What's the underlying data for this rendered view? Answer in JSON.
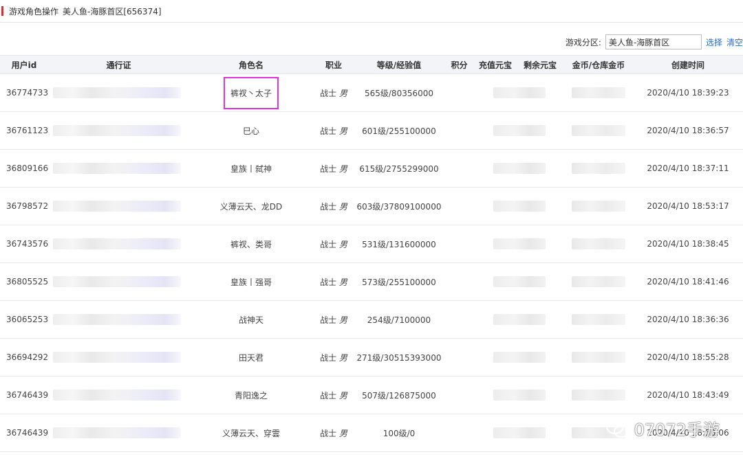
{
  "header": {
    "title": "游戏角色操作",
    "zone": "美人鱼-海豚首区[656374]"
  },
  "filter": {
    "label": "游戏分区:",
    "value": "美人鱼-海豚首区",
    "select_link": "选择",
    "clear_link": "清空"
  },
  "table": {
    "columns": [
      "用户id",
      "通行证",
      "角色名",
      "职业",
      "等级/经验值",
      "积分",
      "充值元宝",
      "剩余元宝",
      "金币/仓库金币",
      "创建时间"
    ],
    "rows": [
      {
        "uid": "36774733",
        "role": "裤衩丶太子",
        "job": "战士",
        "gender": "男",
        "level": "565级/80356000",
        "created": "2020/4/10 18:39:23"
      },
      {
        "uid": "36761123",
        "role": "巳心",
        "job": "战士",
        "gender": "男",
        "level": "601级/255100000",
        "created": "2020/4/10 18:36:57"
      },
      {
        "uid": "36809166",
        "role": "皇族丨弑神",
        "job": "战士",
        "gender": "男",
        "level": "615级/2755299000",
        "created": "2020/4/10 18:37:11"
      },
      {
        "uid": "36798572",
        "role": "义薄云天、龙DD",
        "job": "战士",
        "gender": "男",
        "level": "603级/37809100000",
        "created": "2020/4/10 18:53:17"
      },
      {
        "uid": "36743576",
        "role": "裤衩、类哥",
        "job": "战士",
        "gender": "男",
        "level": "531级/131600000",
        "created": "2020/4/10 18:38:45"
      },
      {
        "uid": "36805525",
        "role": "皇族丨强哥",
        "job": "战士",
        "gender": "男",
        "level": "573级/255100000",
        "created": "2020/4/10 18:41:46"
      },
      {
        "uid": "36065253",
        "role": "战神天",
        "job": "战士",
        "gender": "男",
        "level": "254级/7100000",
        "created": "2020/4/10 18:36:36"
      },
      {
        "uid": "36694292",
        "role": "田天君",
        "job": "战士",
        "gender": "男",
        "level": "271级/30515393000",
        "created": "2020/4/10 18:55:28"
      },
      {
        "uid": "36746439",
        "role": "青阳逸之",
        "job": "战士",
        "gender": "男",
        "level": "507级/126875000",
        "created": "2020/4/10 18:43:49"
      },
      {
        "uid": "36746439",
        "role": "义薄云天、穿雲",
        "job": "战士",
        "gender": "男",
        "level": "100级/0",
        "created": "2020/4/10 18:50:06"
      }
    ]
  },
  "watermark": {
    "text": "07072手游",
    "icon": "wechat-icon"
  },
  "colors": {
    "accent_red": "#d9302d",
    "highlight": "#e332dc",
    "link": "#2b6cc4"
  }
}
